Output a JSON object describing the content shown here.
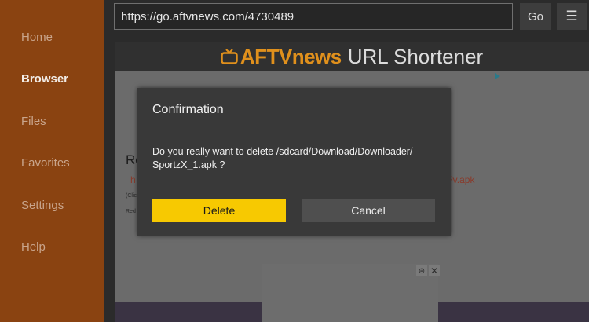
{
  "sidebar": {
    "items": [
      {
        "label": "Home",
        "active": false
      },
      {
        "label": "Browser",
        "active": true
      },
      {
        "label": "Files",
        "active": false
      },
      {
        "label": "Favorites",
        "active": false
      },
      {
        "label": "Settings",
        "active": false
      },
      {
        "label": "Help",
        "active": false
      }
    ]
  },
  "toolbar": {
    "url": "https://go.aftvnews.com/4730489",
    "go_label": "Go",
    "menu_icon": "hamburger-icon",
    "menu_glyph": "☰"
  },
  "webpage": {
    "brand": "AFTVnews",
    "title": "URL Shortener",
    "partial_heading": "Re",
    "partial_link_left": "h",
    "partial_link_right": "?v.apk",
    "partial_small_1": "(Clic",
    "partial_small_2": "Red"
  },
  "dialog": {
    "title": "Confirmation",
    "message": "Do you really want to delete /sdcard/Download/Downloader/ SportzX_1.apk ?",
    "delete_label": "Delete",
    "cancel_label": "Cancel"
  },
  "colors": {
    "sidebar_bg": "#8a4311",
    "accent_yellow": "#f7c901",
    "brand_orange": "#e0901c"
  }
}
